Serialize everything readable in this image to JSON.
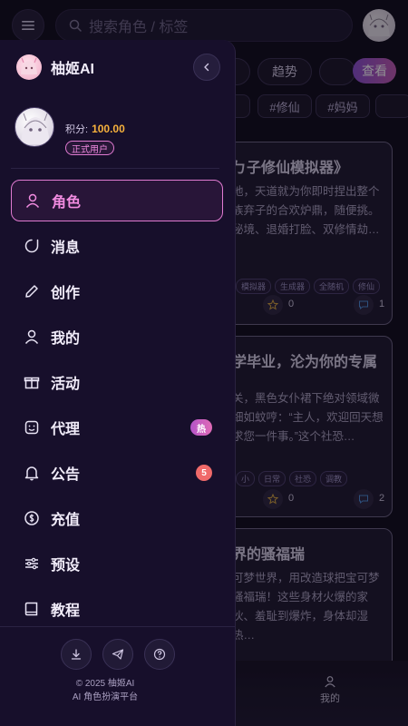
{
  "search": {
    "placeholder": "搜索角色 / 标签"
  },
  "filters": {
    "trending": "趋势",
    "view": "查看"
  },
  "tags": [
    "#修仙",
    "#妈妈"
  ],
  "cards": [
    {
      "title": "ㄅ子修仙模拟器》",
      "desc": "地，天道就为你即时捏出整个族弃子的合欢炉鼎，随便挑。秘境、退婚打脸、双修情劫…",
      "tags": [
        "模拟器",
        "生成器",
        "全随机",
        "修仙"
      ],
      "likes": "0",
      "chats": "1"
    },
    {
      "title": "学毕业，沦为你的专属",
      "desc": "关，黑色女仆裙下绝对领域微细如蚊哼：“主人，欢迎回天想求您一件事。”这个社恐…",
      "tags": [
        "小",
        "日常",
        "社恐",
        "调教"
      ],
      "likes": "0",
      "chats": "2"
    },
    {
      "title": "界的骚福瑞",
      "desc": "可梦世界，用改造球把宝可梦骚福瑞！这些身材火爆的家伙、羞耻到爆炸，身体却湿热…",
      "tags": [],
      "likes": "",
      "chats": ""
    }
  ],
  "bottom_nav": {
    "me": "我的"
  },
  "drawer": {
    "brand": "柚姬AI",
    "points_label": "积分:",
    "points_value": "100.00",
    "member_badge": "正式用户",
    "menu": [
      {
        "label": "角色",
        "icon": "user-icon",
        "active": true
      },
      {
        "label": "消息",
        "icon": "message-icon"
      },
      {
        "label": "创作",
        "icon": "pencil-icon"
      },
      {
        "label": "我的",
        "icon": "profile-icon"
      },
      {
        "label": "活动",
        "icon": "gift-icon"
      },
      {
        "label": "代理",
        "icon": "smile-icon",
        "badge": "热"
      },
      {
        "label": "公告",
        "icon": "bell-icon",
        "badge": "5"
      },
      {
        "label": "充值",
        "icon": "coin-icon"
      },
      {
        "label": "预设",
        "icon": "sliders-icon"
      },
      {
        "label": "教程",
        "icon": "book-icon"
      }
    ],
    "footer": {
      "copyright": "© 2025 柚姬AI",
      "tagline": "AI 角色扮演平台"
    }
  },
  "colors": {
    "accent": "#e07ad1",
    "points": "#f6b13c",
    "badge_red": "#f06a6a"
  }
}
